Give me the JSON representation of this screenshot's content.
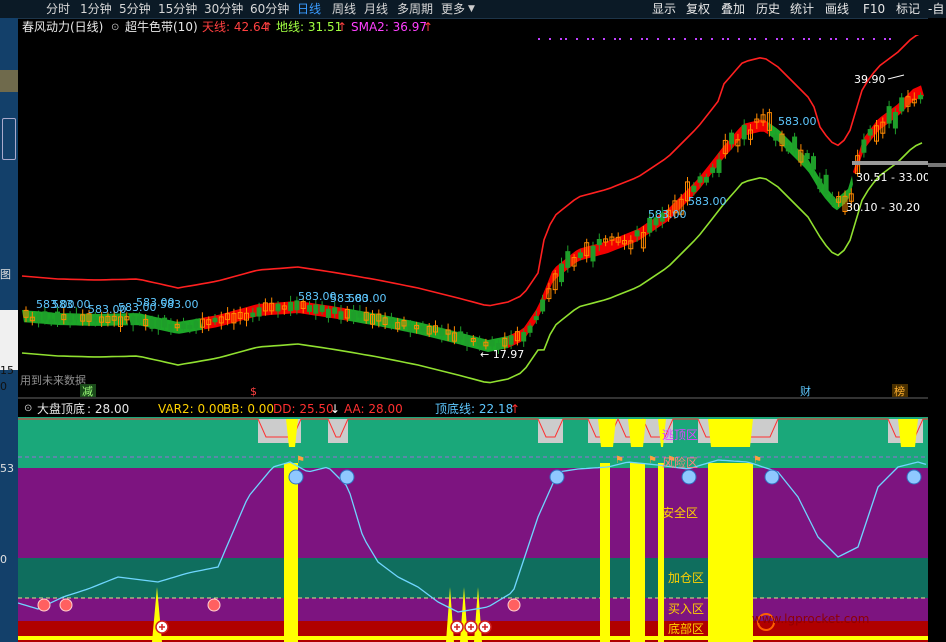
{
  "toolbar": {
    "periods": [
      "分时",
      "1分钟",
      "5分钟",
      "15分钟",
      "30分钟",
      "60分钟",
      "日线",
      "周线",
      "月线",
      "多周期",
      "更多"
    ],
    "active_period": "日线",
    "right_menu": [
      "显示",
      "复权",
      "叠加",
      "历史",
      "统计",
      "画线",
      "F10",
      "标记",
      "-自"
    ]
  },
  "left_panel": {
    "labels": [
      "图",
      "15",
      "0",
      "53",
      "0"
    ]
  },
  "main_chart": {
    "indicator_name": "春风动力(日线)",
    "band_name": "超牛色带(10)",
    "tian_label": "天线: 42.64",
    "di_label": "地线: 31.51",
    "sma_label": "SMA2: 36.97",
    "future_data_text": "用到未来数据",
    "bottom_marks": [
      "减",
      "$",
      "财",
      "榜"
    ],
    "annotations": [
      {
        "text": "583.00",
        "color": "#5ec8ff"
      },
      {
        "text": "583.00",
        "color": "#5ec8ff"
      },
      {
        "text": "583.00",
        "color": "#5ec8ff"
      },
      {
        "text": "583.00",
        "color": "#5ec8ff"
      },
      {
        "text": "583.00",
        "color": "#5ec8ff"
      },
      {
        "text": "583.00",
        "color": "#5ec8ff"
      },
      {
        "text": "583.00",
        "color": "#5ec8ff"
      },
      {
        "text": "583.00",
        "color": "#5ec8ff"
      },
      {
        "text": "583.00",
        "color": "#5ec8ff"
      },
      {
        "text": "583.00",
        "color": "#5ec8ff"
      },
      {
        "text": "583.00",
        "color": "#5ec8ff"
      },
      {
        "text": "583.00",
        "color": "#5ec8ff"
      }
    ],
    "price_high_label": "39.90",
    "price_low_label": "← 17.97",
    "range_label_1": "30.51 - 33.00",
    "range_label_2": "30.10 - 30.20",
    "colors": {
      "up": "#ff8a00",
      "down": "#1f9e2a",
      "tian": "#ff2020",
      "di": "#90e030",
      "band_up": "#ff0000",
      "band_down": "#1fb02a",
      "sma": "#ff00ff"
    }
  },
  "sub_chart": {
    "title": "大盘顶底",
    "title_value": ": 28.00",
    "var2": "VAR2: 0.00",
    "bb": "BB: 0.00",
    "dd": "DD: 25.50",
    "dd_arrow": "↓",
    "aa": "AA: 28.00",
    "top_bottom": "顶底线: 22.18",
    "top_bottom_arrow": "↑",
    "zones": [
      "逃顶区",
      "风险区",
      "安全区",
      "加仓区",
      "买入区",
      "底部区"
    ],
    "colors": {
      "escape": "#1aa87a",
      "risk": "#1aa87a",
      "safe": "#7d1480",
      "add": "#0f6e5e",
      "buy": "#7d1480",
      "bottom": "#b00000",
      "line": "#6fd6ff",
      "yellow": "#ffff00"
    }
  },
  "watermark": "www.lgprocket.com"
}
